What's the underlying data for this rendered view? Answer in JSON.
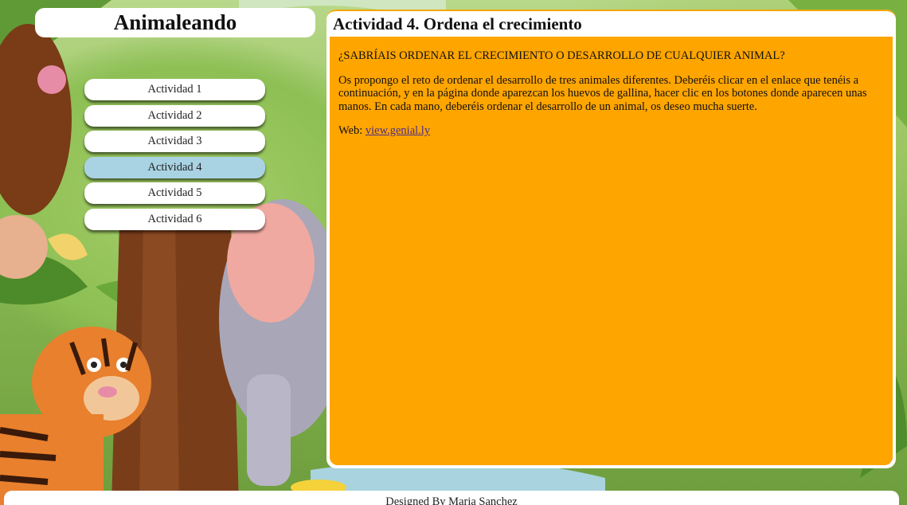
{
  "site": {
    "title": "Animaleando"
  },
  "menu": {
    "items": [
      {
        "label": "Actividad 1",
        "active": false
      },
      {
        "label": "Actividad 2",
        "active": false
      },
      {
        "label": "Actividad 3",
        "active": false
      },
      {
        "label": "Actividad 4",
        "active": true
      },
      {
        "label": "Actividad 5",
        "active": false
      },
      {
        "label": "Actividad 6",
        "active": false
      }
    ]
  },
  "content": {
    "heading": "Actividad 4. Ordena el crecimiento",
    "question": "¿SABRÍAIS ORDENAR EL CRECIMIENTO O DESARROLLO DE CUALQUIER ANIMAL?",
    "description": "Os propongo el reto de ordenar el desarrollo de tres animales diferentes. Deberéis clicar en el enlace que tenéis a continuación, y en la página donde aparezcan los huevos de gallina, hacer clic en los botones donde aparecen unas manos. En cada mano, deberéis ordenar el desarrollo de un animal, os deseo mucha suerte.",
    "web_label": "Web:",
    "web_link": "view.genial.ly"
  },
  "footer": {
    "text": "Designed By Maria Sanchez"
  },
  "colors": {
    "panel_body": "#ffa500",
    "active_item": "#a9d3e3",
    "accent_border": "#f3a600"
  }
}
